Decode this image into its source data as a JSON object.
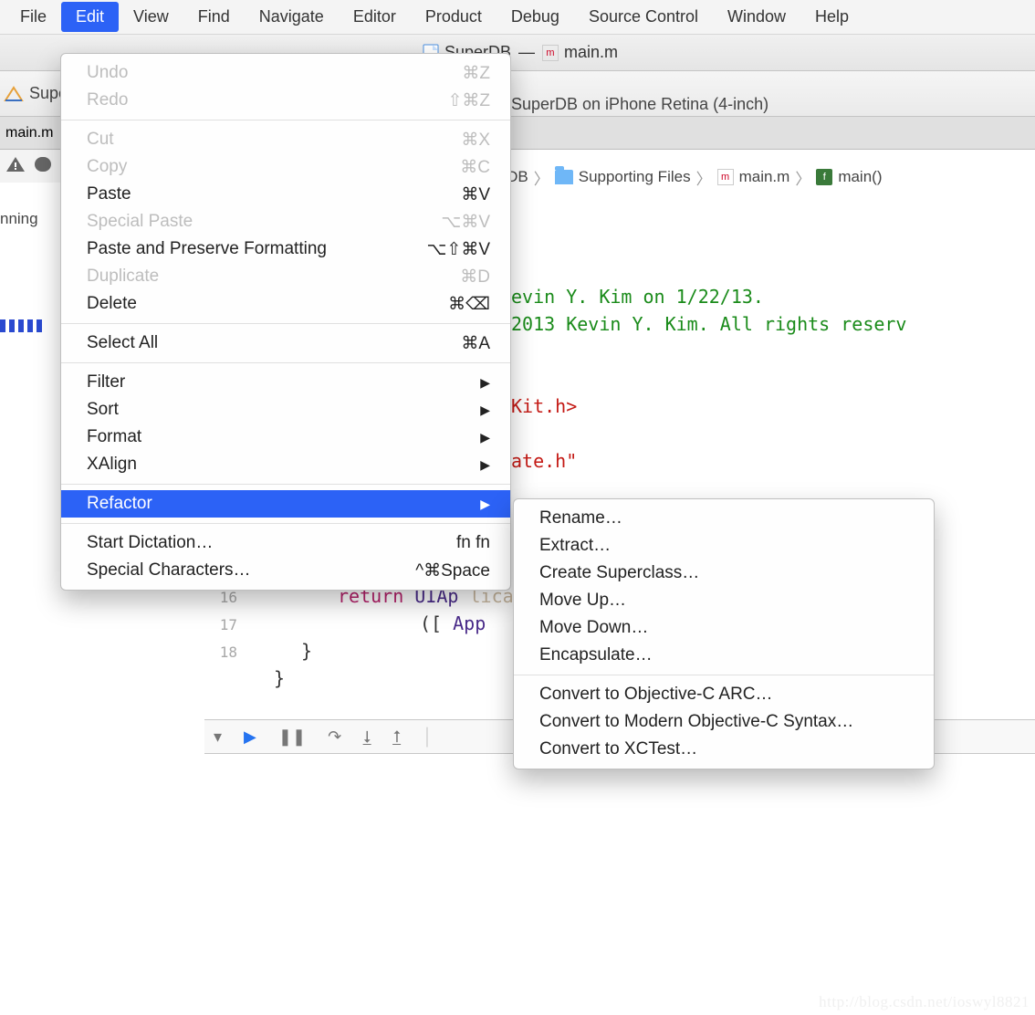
{
  "menubar": {
    "items": [
      "File",
      "Edit",
      "View",
      "Find",
      "Navigate",
      "Editor",
      "Product",
      "Debug",
      "Source Control",
      "Window",
      "Help"
    ],
    "active": "Edit"
  },
  "titlebar": {
    "project": "SuperDB",
    "separator": "—",
    "file": "main.m"
  },
  "toolbar": {
    "label_left": "Supe",
    "status": "SuperDB on iPhone Retina (4-inch)"
  },
  "tabbar": {
    "tab0": "main.m"
  },
  "sidebar": {
    "status": "nning"
  },
  "breadcrumb": {
    "seg0": "erDB",
    "seg1": "Supporting Files",
    "seg2": "main.m",
    "seg3": "main()"
  },
  "code": {
    "l1": "evin Y. Kim on 1/22/13.",
    "l2": " 2013 Kevin Y. Kim. All rights reserv",
    "l3": "Kit.h>",
    "l4": "ate.h\"",
    "l5a": "return",
    "l5b": " UIAp",
    "l5_faded": "licationMain(argc, argv, nil, NSS",
    "l6a": "([",
    "l6b": "App",
    "l7": "}",
    "l8": "}",
    "g16": "16",
    "g17": "17",
    "g18": "18"
  },
  "edit_menu": {
    "undo": {
      "label": "Undo",
      "sc": "⌘Z"
    },
    "redo": {
      "label": "Redo",
      "sc": "⇧⌘Z"
    },
    "cut": {
      "label": "Cut",
      "sc": "⌘X"
    },
    "copy": {
      "label": "Copy",
      "sc": "⌘C"
    },
    "paste": {
      "label": "Paste",
      "sc": "⌘V"
    },
    "special_paste": {
      "label": "Special Paste",
      "sc": "⌥⌘V"
    },
    "paste_preserve": {
      "label": "Paste and Preserve Formatting",
      "sc": "⌥⇧⌘V"
    },
    "duplicate": {
      "label": "Duplicate",
      "sc": "⌘D"
    },
    "delete": {
      "label": "Delete",
      "sc": "⌘⌫"
    },
    "select_all": {
      "label": "Select All",
      "sc": "⌘A"
    },
    "filter": {
      "label": "Filter"
    },
    "sort": {
      "label": "Sort"
    },
    "format": {
      "label": "Format"
    },
    "xalign": {
      "label": "XAlign"
    },
    "refactor": {
      "label": "Refactor"
    },
    "start_dictation": {
      "label": "Start Dictation…",
      "sc": "fn fn"
    },
    "special_chars": {
      "label": "Special Characters…",
      "sc": "^⌘Space"
    }
  },
  "refactor_menu": {
    "rename": "Rename…",
    "extract": "Extract…",
    "create_super": "Create Superclass…",
    "move_up": "Move Up…",
    "move_down": "Move Down…",
    "encapsulate": "Encapsulate…",
    "arc": "Convert to Objective-C ARC…",
    "modern": "Convert to Modern Objective-C Syntax…",
    "xctest": "Convert to XCTest…"
  },
  "watermark": "http://blog.csdn.net/ioswyl8821"
}
